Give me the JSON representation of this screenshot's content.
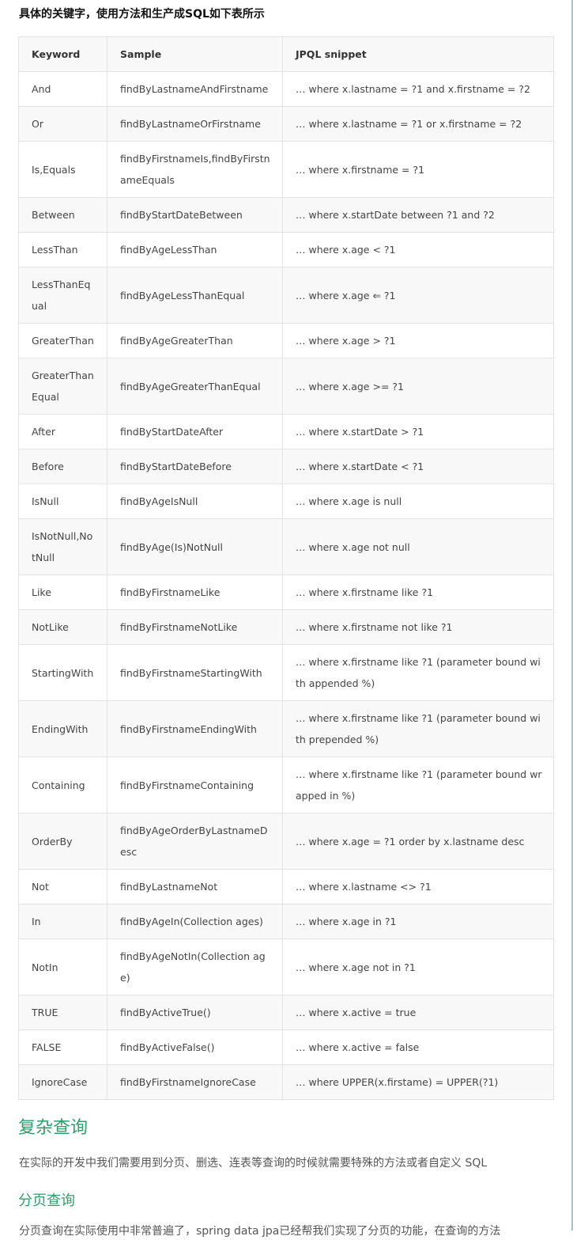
{
  "intro": "具体的关键字，使用方法和生产成SQL如下表所示",
  "table": {
    "headers": [
      "Keyword",
      "Sample",
      "JPQL snippet"
    ],
    "rows": [
      {
        "keyword": "And",
        "sample": "findByLastnameAndFirstname",
        "jpql": "… where x.lastname = ?1 and x.firstname = ?2",
        "tall": false
      },
      {
        "keyword": "Or",
        "sample": "findByLastnameOrFirstname",
        "jpql": "… where x.lastname = ?1 or x.firstname = ?2",
        "tall": false
      },
      {
        "keyword": "Is,Equals",
        "sample": "findByFirstnameIs,findByFirstnameEquals",
        "jpql": "… where x.firstname = ?1",
        "tall": true
      },
      {
        "keyword": "Between",
        "sample": "findByStartDateBetween",
        "jpql": "… where x.startDate between ?1 and ?2",
        "tall": false
      },
      {
        "keyword": "LessThan",
        "sample": "findByAgeLessThan",
        "jpql": "… where x.age < ?1",
        "tall": false
      },
      {
        "keyword": "LessThanEqual",
        "sample": "findByAgeLessThanEqual",
        "jpql": "… where x.age ⇐ ?1",
        "tall": true
      },
      {
        "keyword": "GreaterThan",
        "sample": "findByAgeGreaterThan",
        "jpql": "… where x.age > ?1",
        "tall": false
      },
      {
        "keyword": "GreaterThanEqual",
        "sample": "findByAgeGreaterThanEqual",
        "jpql": "… where x.age >= ?1",
        "tall": true
      },
      {
        "keyword": "After",
        "sample": "findByStartDateAfter",
        "jpql": "… where x.startDate > ?1",
        "tall": false
      },
      {
        "keyword": "Before",
        "sample": "findByStartDateBefore",
        "jpql": "… where x.startDate < ?1",
        "tall": false
      },
      {
        "keyword": "IsNull",
        "sample": "findByAgeIsNull",
        "jpql": "… where x.age is null",
        "tall": false
      },
      {
        "keyword": "IsNotNull,NotNull",
        "sample": "findByAge(Is)NotNull",
        "jpql": "… where x.age not null",
        "tall": true
      },
      {
        "keyword": "Like",
        "sample": "findByFirstnameLike",
        "jpql": "… where x.firstname like ?1",
        "tall": false
      },
      {
        "keyword": "NotLike",
        "sample": "findByFirstnameNotLike",
        "jpql": "… where x.firstname not like ?1",
        "tall": false
      },
      {
        "keyword": "StartingWith",
        "sample": "findByFirstnameStartingWith",
        "jpql": "… where x.firstname like ?1 (parameter bound with appended %)",
        "tall": true
      },
      {
        "keyword": "EndingWith",
        "sample": "findByFirstnameEndingWith",
        "jpql": "… where x.firstname like ?1 (parameter bound with prepended %)",
        "tall": true
      },
      {
        "keyword": "Containing",
        "sample": "findByFirstnameContaining",
        "jpql": "… where x.firstname like ?1 (parameter bound wrapped in %)",
        "tall": true
      },
      {
        "keyword": "OrderBy",
        "sample": "findByAgeOrderByLastnameDesc",
        "jpql": "… where x.age = ?1 order by x.lastname desc",
        "tall": true
      },
      {
        "keyword": "Not",
        "sample": "findByLastnameNot",
        "jpql": "… where x.lastname <> ?1",
        "tall": false
      },
      {
        "keyword": "In",
        "sample": "findByAgeIn(Collection ages)",
        "jpql": "… where x.age in ?1",
        "tall": false
      },
      {
        "keyword": "NotIn",
        "sample": "findByAgeNotIn(Collection age)",
        "jpql": "… where x.age not in ?1",
        "tall": true
      },
      {
        "keyword": "TRUE",
        "sample": "findByActiveTrue()",
        "jpql": "… where x.active = true",
        "tall": false
      },
      {
        "keyword": "FALSE",
        "sample": "findByActiveFalse()",
        "jpql": "… where x.active = false",
        "tall": false
      },
      {
        "keyword": "IgnoreCase",
        "sample": "findByFirstnameIgnoreCase",
        "jpql": "… where UPPER(x.firstame) = UPPER(?1)",
        "tall": false
      }
    ]
  },
  "section_heading": "复杂查询",
  "section_paragraph": "在实际的开发中我们需要用到分页、删选、连表等查询的时候就需要特殊的方法或者自定义 SQL",
  "sub_heading": "分页查询",
  "cut_line": "分页查询在实际使用中非常普遍了，spring data jpa已经帮我们实现了分页的功能，在查询的方法"
}
